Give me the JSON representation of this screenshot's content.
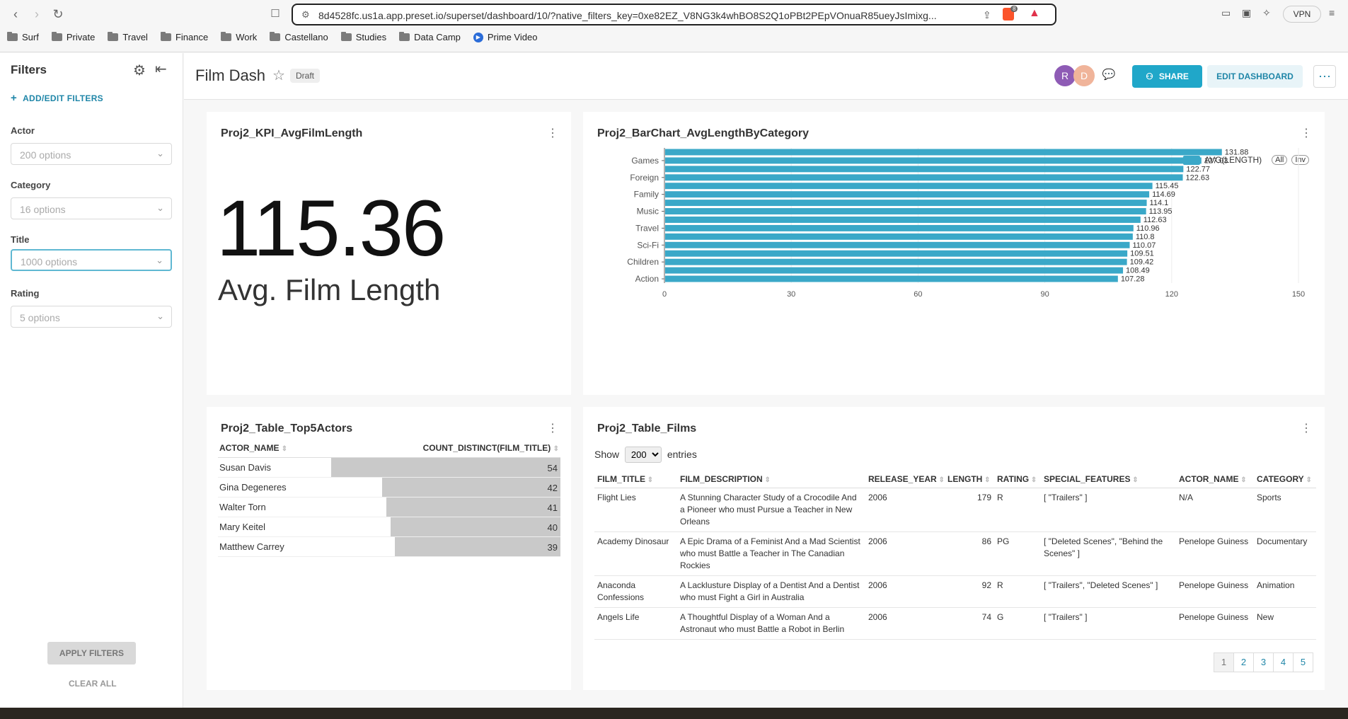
{
  "browser": {
    "url": "8d4528fc.us1a.app.preset.io/superset/dashboard/10/?native_filters_key=0xe82EZ_V8NG3k4whBO8S2Q1oPBt2PEpVOnuaR85ueyJsImixg...",
    "bookmarks": [
      "Surf",
      "Private",
      "Travel",
      "Finance",
      "Work",
      "Castellano",
      "Studies",
      "Data Camp",
      "Prime Video"
    ],
    "vpn_label": "VPN",
    "badge_count": "8"
  },
  "sidebar": {
    "title": "Filters",
    "add_edit": "ADD/EDIT FILTERS",
    "filters": [
      {
        "label": "Actor",
        "placeholder": "200 options"
      },
      {
        "label": "Category",
        "placeholder": "16 options"
      },
      {
        "label": "Title",
        "placeholder": "1000 options"
      },
      {
        "label": "Rating",
        "placeholder": "5 options"
      }
    ],
    "apply": "APPLY FILTERS",
    "clear": "CLEAR ALL"
  },
  "header": {
    "title": "Film Dash",
    "draft": "Draft",
    "avatars": [
      "R",
      "D"
    ],
    "share": "SHARE",
    "edit": "EDIT DASHBOARD"
  },
  "kpi": {
    "title": "Proj2_KPI_AvgFilmLength",
    "value": "115.36",
    "subtitle": "Avg. Film Length"
  },
  "barchart": {
    "title": "Proj2_BarChart_AvgLengthByCategory",
    "legend": "AVG(LENGTH)",
    "legend_all": "All",
    "legend_inv": "Inv"
  },
  "chart_data": {
    "type": "bar",
    "orientation": "horizontal",
    "series": [
      {
        "name": "AVG(LENGTH)",
        "values": [
          131.88,
          127.03,
          122.77,
          122.63,
          115.45,
          114.69,
          114.1,
          113.95,
          112.63,
          110.96,
          110.8,
          110.07,
          109.51,
          109.42,
          108.49,
          107.28
        ]
      }
    ],
    "category_tick_labels": [
      "Games",
      "Foreign",
      "Family",
      "Music",
      "Travel",
      "Sci-Fi",
      "Children",
      "Action"
    ],
    "xlim": [
      0,
      150
    ],
    "xticks": [
      0,
      30,
      60,
      90,
      120,
      150
    ],
    "color": "#3aa8c8"
  },
  "top5": {
    "title": "Proj2_Table_Top5Actors",
    "columns": [
      "ACTOR_NAME",
      "COUNT_DISTINCT(FILM_TITLE)"
    ],
    "rows": [
      {
        "name": "Susan Davis",
        "count": 54
      },
      {
        "name": "Gina Degeneres",
        "count": 42
      },
      {
        "name": "Walter Torn",
        "count": 41
      },
      {
        "name": "Mary Keitel",
        "count": 40
      },
      {
        "name": "Matthew Carrey",
        "count": 39
      }
    ]
  },
  "films": {
    "title": "Proj2_Table_Films",
    "show_label": "Show",
    "show_value": "200",
    "entries_label": "entries",
    "columns": [
      "FILM_TITLE",
      "FILM_DESCRIPTION",
      "RELEASE_YEAR",
      "LENGTH",
      "RATING",
      "SPECIAL_FEATURES",
      "ACTOR_NAME",
      "CATEGORY"
    ],
    "rows": [
      [
        "Flight Lies",
        "A Stunning Character Study of a Crocodile And a Pioneer who must Pursue a Teacher in New Orleans",
        "2006",
        "179",
        "R",
        "[ \"Trailers\" ]",
        "N/A",
        "Sports"
      ],
      [
        "Academy Dinosaur",
        "A Epic Drama of a Feminist And a Mad Scientist who must Battle a Teacher in The Canadian Rockies",
        "2006",
        "86",
        "PG",
        "[ \"Deleted Scenes\", \"Behind the Scenes\" ]",
        "Penelope Guiness",
        "Documentary"
      ],
      [
        "Anaconda Confessions",
        "A Lacklusture Display of a Dentist And a Dentist who must Fight a Girl in Australia",
        "2006",
        "92",
        "R",
        "[ \"Trailers\", \"Deleted Scenes\" ]",
        "Penelope Guiness",
        "Animation"
      ],
      [
        "Angels Life",
        "A Thoughtful Display of a Woman And a Astronaut who must Battle a Robot in Berlin",
        "2006",
        "74",
        "G",
        "[ \"Trailers\" ]",
        "Penelope Guiness",
        "New"
      ]
    ],
    "pages": [
      "1",
      "2",
      "3",
      "4",
      "5"
    ]
  }
}
